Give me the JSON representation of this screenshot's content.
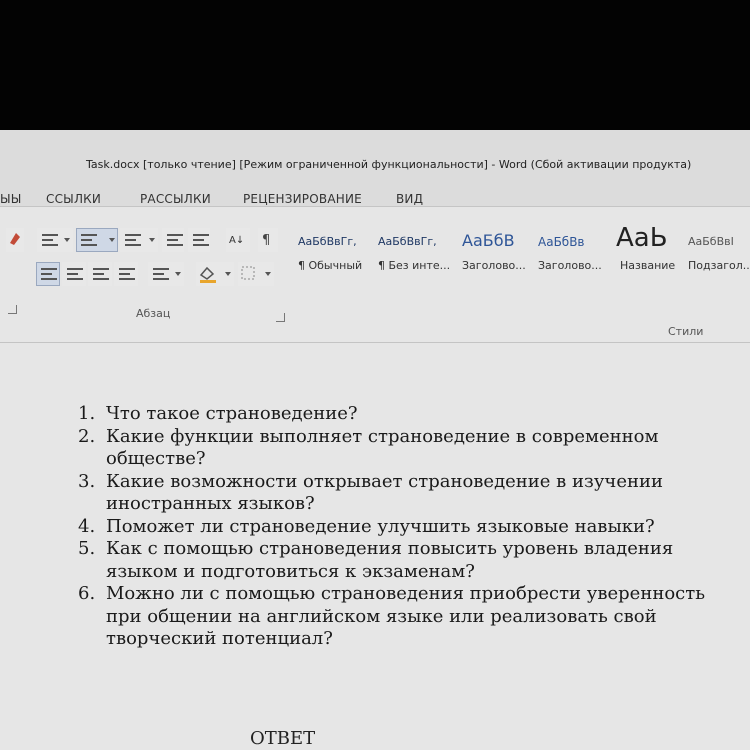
{
  "window": {
    "title": "Task.docx [только чтение] [Режим ограниченной функциональности] - Word (Сбой активации продукта)"
  },
  "ribbon_tabs": [
    "ЫЫ",
    "ССЫЛКИ",
    "РАССЫЛКИ",
    "РЕЦЕНЗИРОВАНИЕ",
    "ВИД"
  ],
  "ribbon": {
    "paragraph_group_label": "Абзац",
    "styles_group_label": "Стили",
    "styles": [
      {
        "sample": "АаБбВвГг,",
        "name": "¶ Обычный"
      },
      {
        "sample": "АаБбВвГг,",
        "name": "¶ Без инте..."
      },
      {
        "sample": "АаБбВ",
        "name": "Заголово..."
      },
      {
        "sample": "АаБбВв",
        "name": "Заголово..."
      },
      {
        "sample": "АаЬ",
        "name": "Название"
      },
      {
        "sample": "АаБбВвI",
        "name": "Подзагол..."
      }
    ]
  },
  "document": {
    "questions": [
      {
        "num": "1.",
        "text": "Что такое страноведение?"
      },
      {
        "num": "2.",
        "text": "Какие функции выполняет страноведение в современном обществе?"
      },
      {
        "num": "3.",
        "text": "Какие возможности открывает страноведение в изучении иностранных языков?"
      },
      {
        "num": "4.",
        "text": "Поможет ли страноведение улучшить языковые навыки?"
      },
      {
        "num": "5.",
        "text": "Как с помощью страноведения повысить уровень владения языком и подготовиться к экзаменам?"
      },
      {
        "num": "6.",
        "text": "Можно ли с помощью страноведения приобрести уверенность при общении на английском языке или реализовать свой творческий потенциал?"
      }
    ],
    "answer_heading": "ОТВЕТ"
  }
}
